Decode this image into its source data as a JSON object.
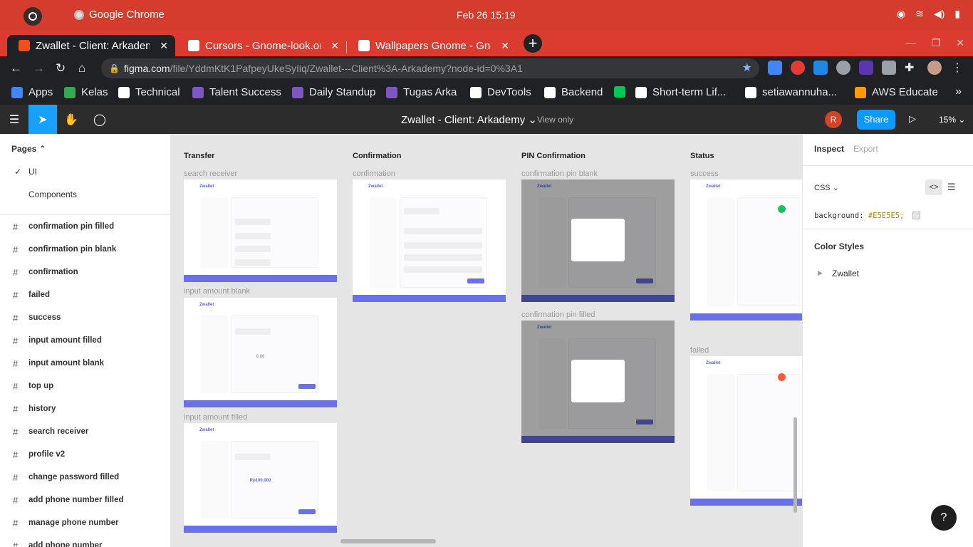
{
  "gnome": {
    "app_name": "Google Chrome",
    "clock": "Feb 26  15:19"
  },
  "tabs": [
    {
      "title": "Zwallet - Client: Arkademy",
      "favicon_color": "#f24e1e"
    },
    {
      "title": "Cursors - Gnome-look.org",
      "favicon_color": "#ffffff"
    },
    {
      "title": "Wallpapers Gnome - Gnome",
      "favicon_color": "#ffffff"
    }
  ],
  "omnibox": {
    "host": "figma.com",
    "path": "/file/YddmKtK1PafpeyUkeSyIiq/Zwallet---Client%3A-Arkademy?node-id=0%3A1"
  },
  "bookmarks": [
    {
      "label": "Apps",
      "color": "#4285f4"
    },
    {
      "label": "Kelas",
      "color": "#34a853"
    },
    {
      "label": "Technical",
      "color": "#ffffff"
    },
    {
      "label": "Talent Success",
      "color": "#7e57c2"
    },
    {
      "label": "Daily Standup",
      "color": "#7e57c2"
    },
    {
      "label": "Tugas Arka",
      "color": "#7e57c2"
    },
    {
      "label": "DevTools",
      "color": "#ffffff"
    },
    {
      "label": "Backend",
      "color": "#ffffff"
    },
    {
      "label": "",
      "color": "#00c853"
    },
    {
      "label": "Short-term Lif...",
      "color": "#ffffff"
    },
    {
      "label": "setiawannuha...",
      "color": "#ffffff"
    },
    {
      "label": "AWS Educate",
      "color": "#ff9900"
    }
  ],
  "figma": {
    "file_title": "Zwallet - Client: Arkademy",
    "view_only": "View only",
    "avatar": "R",
    "share": "Share",
    "zoom": "15%"
  },
  "left_panel": {
    "pages_heading": "Pages",
    "pages": [
      "UI",
      "Components"
    ],
    "layers": [
      "confirmation pin filled",
      "confirmation pin blank",
      "confirmation",
      "failed",
      "success",
      "input amount filled",
      "input amount blank",
      "top up",
      "history",
      "search receiver",
      "profile v2",
      "change password filled",
      "add phone number filled",
      "manage phone number",
      "add phone number"
    ]
  },
  "canvas": {
    "sections": [
      "Transfer",
      "Confirmation",
      "PIN Confirmation",
      "Status"
    ],
    "frames": {
      "search_receiver": "search receiver",
      "input_amount_blank": "input amount blank",
      "input_amount_filled": "input amount filled",
      "confirmation": "confirmation",
      "confirmation_pin_blank": "confirmation pin blank",
      "confirmation_pin_filled": "confirmation pin filled",
      "success": "success",
      "failed": "failed"
    },
    "frame_logo": "Zwallet",
    "amount_blank": "0.00",
    "amount_filled": "Rp100.000"
  },
  "right_panel": {
    "tab_inspect": "Inspect",
    "tab_export": "Export",
    "code_lang": "CSS",
    "css_property": "background:",
    "css_value": "#E5E5E5;",
    "color_styles": "Color Styles",
    "style_group": "Zwallet",
    "help": "?"
  },
  "colors": {
    "accent": "#6a70e8",
    "figma_blue": "#0d99ff",
    "chrome_red": "#dc3b2f"
  }
}
